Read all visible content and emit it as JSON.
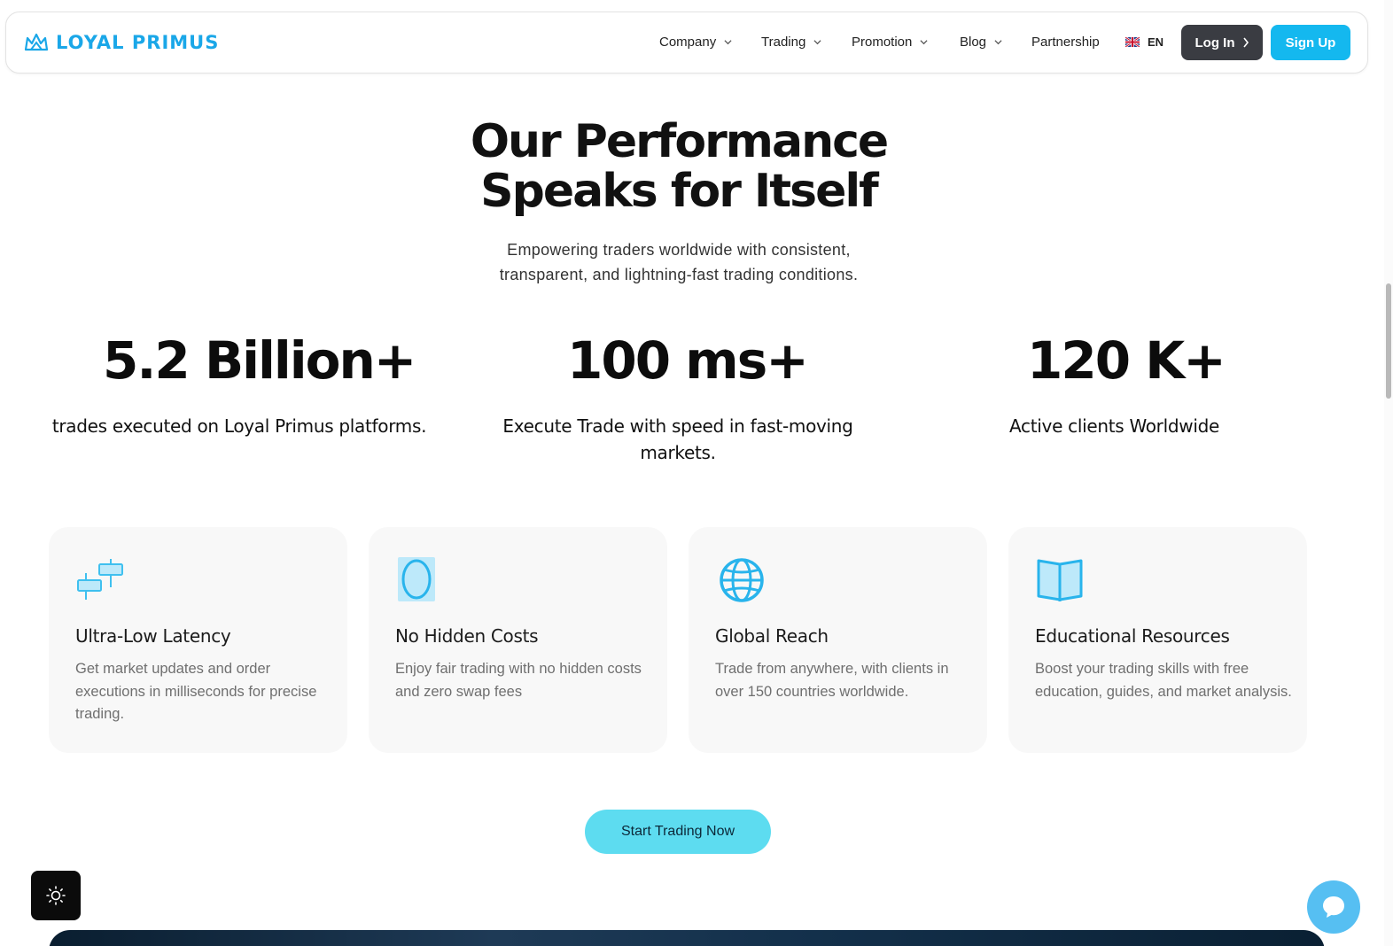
{
  "nav": {
    "brand": "LOYAL PRIMUS",
    "items": [
      {
        "label": "Company",
        "has_dropdown": true
      },
      {
        "label": "Trading",
        "has_dropdown": true
      },
      {
        "label": "Promotion",
        "has_dropdown": true
      },
      {
        "label": "Blog",
        "has_dropdown": true
      },
      {
        "label": "Partnership",
        "has_dropdown": false
      }
    ],
    "language": "EN",
    "login_label": "Log In",
    "signup_label": "Sign Up"
  },
  "hero": {
    "title_line1": "Our Performance",
    "title_line2": "Speaks for Itself",
    "subtitle_line1": "Empowering traders worldwide with consistent,",
    "subtitle_line2": "transparent, and lightning-fast trading conditions."
  },
  "stats": [
    {
      "value": "5.2 Billion+",
      "label": "trades executed on Loyal Primus platforms."
    },
    {
      "value": "100 ms+",
      "label_line1": "Execute Trade with speed in fast-moving",
      "label_line2": "markets."
    },
    {
      "value": "120 K+",
      "label": "Active clients Worldwide"
    }
  ],
  "features": [
    {
      "icon": "candlestick-icon",
      "title": "Ultra-Low Latency",
      "desc": "Get market updates and order executions in milliseconds for precise trading."
    },
    {
      "icon": "zero-icon",
      "title": "No Hidden Costs",
      "desc": "Enjoy fair trading with no hidden costs and zero swap fees"
    },
    {
      "icon": "globe-icon",
      "title": "Global Reach",
      "desc": "Trade from anywhere, with clients in over 150 countries worldwide."
    },
    {
      "icon": "book-icon",
      "title": "Educational Resources",
      "desc": "Boost your trading skills with free education, guides, and market analysis."
    }
  ],
  "cta_label": "Start Trading Now",
  "colors": {
    "accent": "#14b8ef",
    "cta": "#5ddcf0",
    "login_bg": "#3a3c42",
    "card_bg": "#f8f8f8"
  }
}
